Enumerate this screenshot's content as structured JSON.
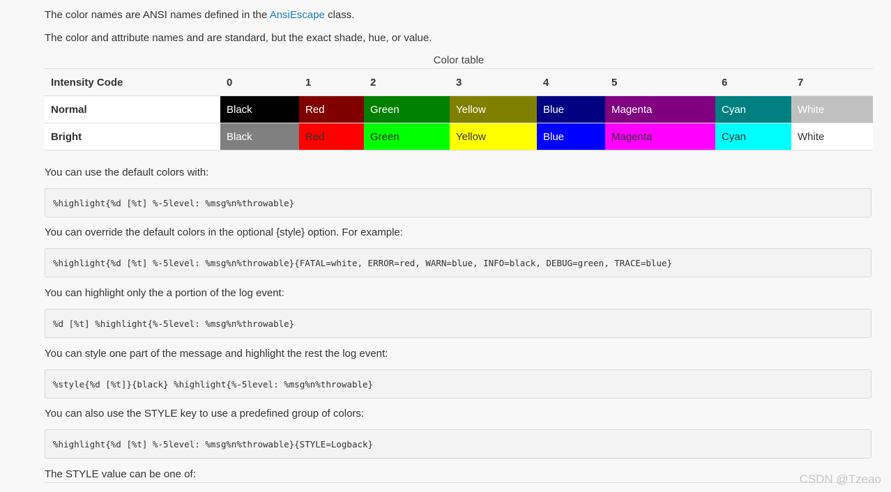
{
  "intro": {
    "line1_prefix": "The color names are ANSI names defined in the ",
    "line1_link": "AnsiEscape",
    "line1_suffix": " class.",
    "line2": "The color and attribute names and are standard, but the exact shade, hue, or value."
  },
  "color_table": {
    "caption": "Color table",
    "header": {
      "label": "Intensity Code",
      "codes": [
        "0",
        "1",
        "2",
        "3",
        "4",
        "5",
        "6",
        "7"
      ]
    },
    "rows": [
      {
        "label": "Normal",
        "cells": [
          {
            "text": "Black",
            "bg": "#000000",
            "fg": "#ffffff"
          },
          {
            "text": "Red",
            "bg": "#800000",
            "fg": "#ffffff"
          },
          {
            "text": "Green",
            "bg": "#008000",
            "fg": "#ffffff"
          },
          {
            "text": "Yellow",
            "bg": "#808000",
            "fg": "#ffffff"
          },
          {
            "text": "Blue",
            "bg": "#000080",
            "fg": "#ffffff"
          },
          {
            "text": "Magenta",
            "bg": "#800080",
            "fg": "#ffffff"
          },
          {
            "text": "Cyan",
            "bg": "#008080",
            "fg": "#ffffff"
          },
          {
            "text": "White",
            "bg": "#c0c0c0",
            "fg": "#ffffff"
          }
        ]
      },
      {
        "label": "Bright",
        "cells": [
          {
            "text": "Black",
            "bg": "#808080",
            "fg": "#ffffff"
          },
          {
            "text": "Red",
            "bg": "#ff0000",
            "fg": "#333333"
          },
          {
            "text": "Green",
            "bg": "#00ff00",
            "fg": "#333333"
          },
          {
            "text": "Yellow",
            "bg": "#ffff00",
            "fg": "#333333"
          },
          {
            "text": "Blue",
            "bg": "#0000ff",
            "fg": "#ffffff"
          },
          {
            "text": "Magenta",
            "bg": "#ff00ff",
            "fg": "#333333"
          },
          {
            "text": "Cyan",
            "bg": "#00ffff",
            "fg": "#333333"
          },
          {
            "text": "White",
            "bg": "#ffffff",
            "fg": "#333333"
          }
        ]
      }
    ]
  },
  "sections": [
    {
      "text": "You can use the default colors with:",
      "code": "%highlight{%d [%t] %-5level: %msg%n%throwable}"
    },
    {
      "text": "You can override the default colors in the optional {style} option. For example:",
      "code": "%highlight{%d [%t] %-5level: %msg%n%throwable}{FATAL=white, ERROR=red, WARN=blue, INFO=black, DEBUG=green, TRACE=blue}"
    },
    {
      "text": "You can highlight only the a portion of the log event:",
      "code": "%d [%t] %highlight{%-5level: %msg%n%throwable}"
    },
    {
      "text": "You can style one part of the message and highlight the rest the log event:",
      "code": "%style{%d [%t]}{black} %highlight{%-5level: %msg%n%throwable}"
    },
    {
      "text": "You can also use the STYLE key to use a predefined group of colors:",
      "code": "%highlight{%d [%t] %-5level: %msg%n%throwable}{STYLE=Logback}"
    }
  ],
  "final_text": "The STYLE value can be one of:",
  "watermark": "CSDN @Tzeao",
  "colors": {
    "link": "#1a7fb8",
    "page_bg": "#f8f8f8",
    "code_bg": "#f3f3f3"
  }
}
